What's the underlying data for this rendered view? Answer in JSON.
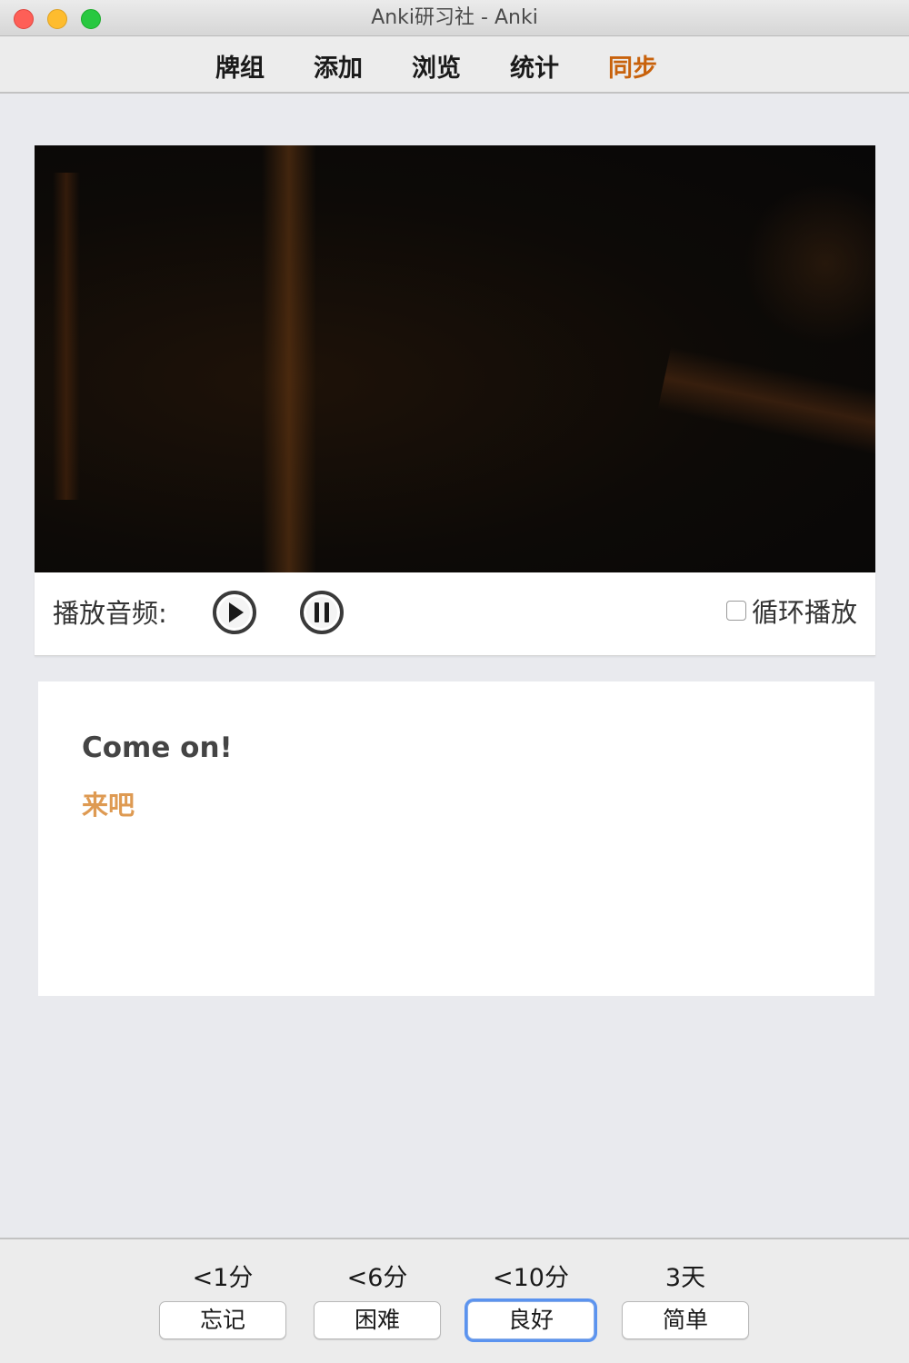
{
  "window": {
    "title": "Anki研习社 - Anki"
  },
  "toolbar": {
    "items": [
      {
        "label": "牌组"
      },
      {
        "label": "添加"
      },
      {
        "label": "浏览"
      },
      {
        "label": "统计"
      },
      {
        "label": "同步"
      }
    ],
    "sync_color": "#c8620c"
  },
  "audio": {
    "label": "播放音频:",
    "play_icon": "play-icon",
    "pause_icon": "pause-icon",
    "loop_label": "循环播放",
    "loop_checked": false
  },
  "card": {
    "english": "Come on!",
    "chinese": "来吧",
    "chinese_color": "#de9a52"
  },
  "answers": [
    {
      "interval": "<1分",
      "label": "忘记"
    },
    {
      "interval": "<6分",
      "label": "困难"
    },
    {
      "interval": "<10分",
      "label": "良好"
    },
    {
      "interval": "3天",
      "label": "简单"
    }
  ],
  "focused_answer": "良好"
}
